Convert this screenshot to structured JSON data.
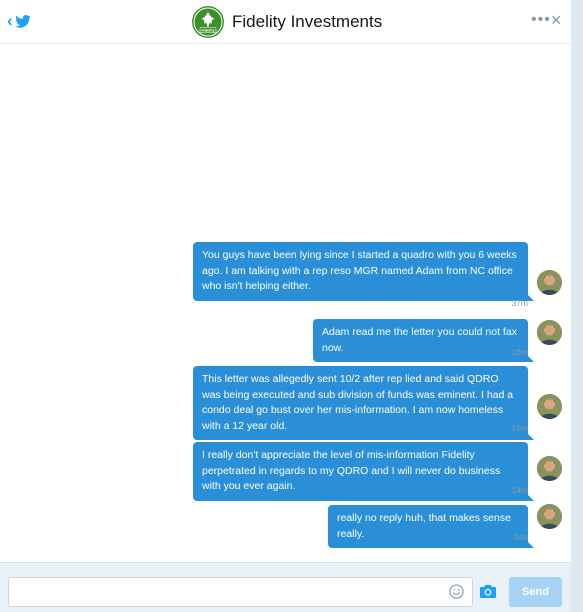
{
  "header": {
    "title": "Fidelity Investments",
    "logo_text": "Fidelity",
    "more_label": "•••",
    "close_label": "×",
    "back_icon": "chevron-left-icon",
    "bird_icon": "twitter-bird-icon"
  },
  "messages": [
    {
      "text": "You guys have been lying since I started a quadro with you 6 weeks ago. I am talking with a rep reso MGR named Adam from NC office who isn't helping either.",
      "time": "37m"
    },
    {
      "text": "Adam read me the letter you could not fax now.",
      "time": "18m"
    },
    {
      "text": "This letter was allegedly sent 10/2 after rep lied and said QDRO was being executed and sub division of funds was eminent.  I had a condo deal go bust over her mis-information. I am now homeless with a 12 year old.",
      "time": "16m"
    },
    {
      "text": "I really don't appreciate the level of mis-information Fidelity perpetrated in regards to my QDRO and I will never do business with you ever again.",
      "time": "14m"
    },
    {
      "text": "really no reply huh, that makes sense really.",
      "time": "34s"
    }
  ],
  "composer": {
    "value": "",
    "placeholder": "",
    "send_label": "Send",
    "emoji_icon": "smiley-icon",
    "camera_icon": "camera-icon"
  },
  "colors": {
    "bubble": "#2b8fd8",
    "accent": "#1da1f2",
    "send_disabled": "#a9d3f5",
    "logo_green": "#3e8f2e"
  }
}
